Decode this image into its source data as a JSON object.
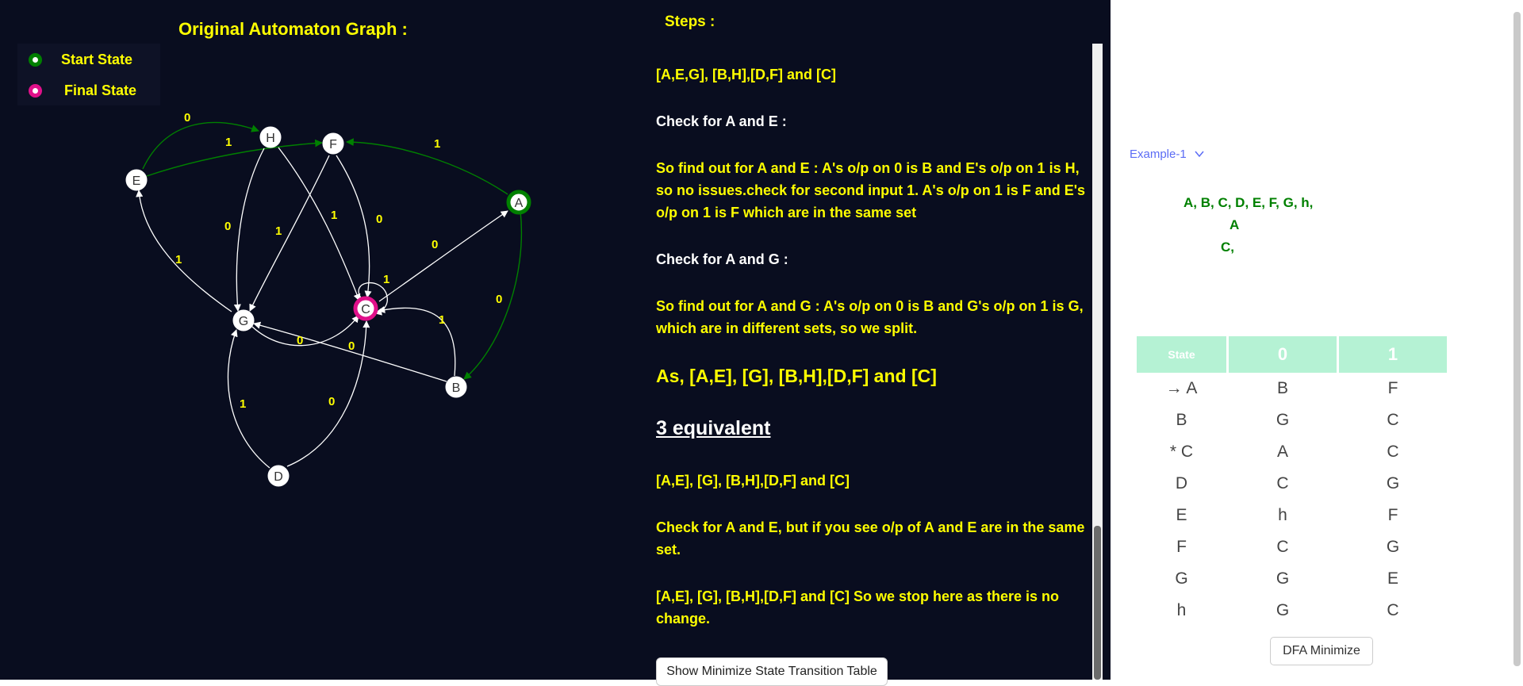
{
  "graph": {
    "title": "Original Automaton Graph :",
    "legend": [
      {
        "label": "Start State",
        "color": "#008000"
      },
      {
        "label": "Final State",
        "color": "#e0108a"
      }
    ],
    "nodes": [
      {
        "id": "A",
        "role": "start"
      },
      {
        "id": "B"
      },
      {
        "id": "C",
        "role": "final"
      },
      {
        "id": "D"
      },
      {
        "id": "E"
      },
      {
        "id": "F"
      },
      {
        "id": "G"
      },
      {
        "id": "H"
      }
    ],
    "edges": [
      {
        "from": "A",
        "to": "B",
        "label": "0",
        "color": "green"
      },
      {
        "from": "A",
        "to": "F",
        "label": "1",
        "color": "green"
      },
      {
        "from": "B",
        "to": "G",
        "label": "0"
      },
      {
        "from": "B",
        "to": "C",
        "label": "1"
      },
      {
        "from": "C",
        "to": "A",
        "label": "0"
      },
      {
        "from": "C",
        "to": "C",
        "label": "1"
      },
      {
        "from": "D",
        "to": "C",
        "label": "0"
      },
      {
        "from": "D",
        "to": "G",
        "label": "1"
      },
      {
        "from": "E",
        "to": "H",
        "label": "0",
        "color": "green"
      },
      {
        "from": "E",
        "to": "F",
        "label": "1",
        "color": "green"
      },
      {
        "from": "F",
        "to": "C",
        "label": "0"
      },
      {
        "from": "F",
        "to": "G",
        "label": "1"
      },
      {
        "from": "G",
        "to": "G",
        "label": "0"
      },
      {
        "from": "G",
        "to": "E",
        "label": "1"
      },
      {
        "from": "H",
        "to": "G",
        "label": "0"
      },
      {
        "from": "H",
        "to": "C",
        "label": "1"
      }
    ],
    "edge_label_list": [
      "0",
      "1",
      "1",
      "0",
      "1",
      "1",
      "0",
      "0",
      "1",
      "1",
      "0",
      "1",
      "0",
      "0",
      "1",
      "0"
    ]
  },
  "steps": {
    "title": "Steps :",
    "items": [
      "[A,E,G], [B,H],[D,F] and [C]",
      "Check for A and E :",
      "So find out for A and E : A's o/p on 0 is B and E's o/p on 1 is H, so no issues.check for second input 1. A's o/p on 1 is F and E's o/p on 1 is F which are in the same set",
      "Check for A and G :",
      "So find out for A and G : A's o/p on 0 is B and G's o/p on 1 is G, which are in different sets, so we split.",
      "As, [A,E], [G], [B,H],[D,F] and [C]",
      "3 equivalent",
      "[A,E], [G], [B,H],[D,F] and [C]",
      "Check for A and E, but if you see o/p of A and E are in the same set.",
      "[A,E], [G], [B,H],[D,F] and [C] So we stop here as there is no change."
    ],
    "show_table_button": "Show Minimize State Transition Table"
  },
  "right_panel": {
    "example_select": "Example-1",
    "states_line1": "A, B, C, D, E, F, G, h,",
    "states_line2": "A",
    "states_line3": "C,",
    "table": {
      "headers": [
        "State",
        "0",
        "1"
      ],
      "rows": [
        [
          "→ A",
          "B",
          "F"
        ],
        [
          "B",
          "G",
          "C"
        ],
        [
          "* C",
          "A",
          "C"
        ],
        [
          "D",
          "C",
          "G"
        ],
        [
          "E",
          "h",
          "F"
        ],
        [
          "F",
          "C",
          "G"
        ],
        [
          "G",
          "G",
          "E"
        ],
        [
          "h",
          "G",
          "C"
        ]
      ]
    },
    "minimize_button": "DFA Minimize"
  },
  "colors": {
    "background": "#090d1f",
    "text_accent": "#ffff00",
    "start_state": "#008000",
    "final_state": "#e0108a",
    "table_header": "#b5f2d4",
    "link": "#5b6cf5"
  }
}
